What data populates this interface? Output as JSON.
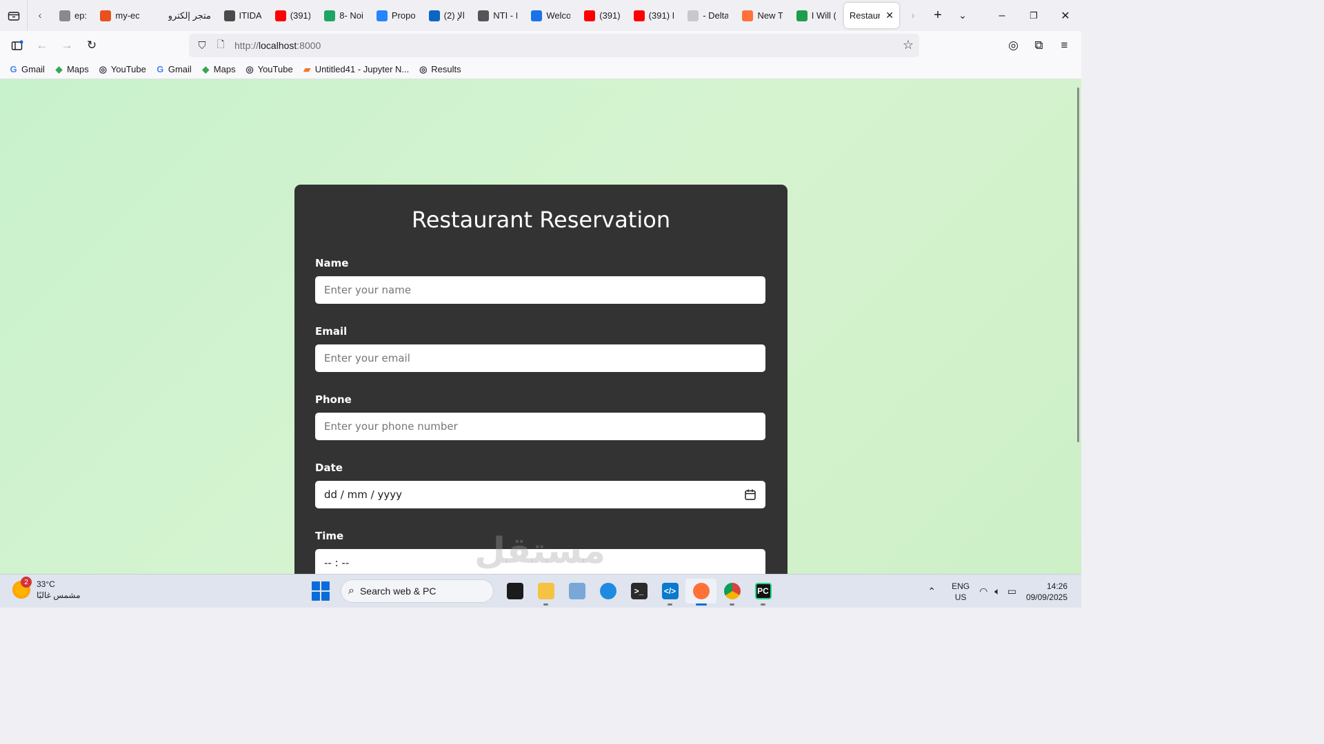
{
  "browser": {
    "tabs": [
      {
        "title": "ep:",
        "icon": "tab-icon",
        "color": "#8a8a8a"
      },
      {
        "title": "my-ec",
        "icon": "flame-icon",
        "color": "#e8501e"
      },
      {
        "title": "متجر إلكترو",
        "icon": "store-icon",
        "color": "#f0f0f4"
      },
      {
        "title": "ITIDA",
        "icon": "itida-icon",
        "color": "#4a4a4a"
      },
      {
        "title": "(391)",
        "icon": "youtube-icon",
        "color": "#ff0000"
      },
      {
        "title": "8- Noi",
        "icon": "drive-icon",
        "color": "#1fa463"
      },
      {
        "title": "Propo",
        "icon": "docs-icon",
        "color": "#2684fc"
      },
      {
        "title": "(2) الإ",
        "icon": "linkedin-icon",
        "color": "#0a66c2"
      },
      {
        "title": "NTI - I",
        "icon": "nti-icon",
        "color": "#555555"
      },
      {
        "title": "Welco",
        "icon": "c-icon",
        "color": "#1a73e8"
      },
      {
        "title": "(391)",
        "icon": "youtube-icon",
        "color": "#ff0000"
      },
      {
        "title": "(391) I",
        "icon": "youtube-icon",
        "color": "#ff0000"
      },
      {
        "title": "- Delta",
        "icon": "page-icon",
        "color": "#c7c7cc"
      },
      {
        "title": "New T",
        "icon": "firefox-icon",
        "color": "#ff7139"
      },
      {
        "title": "I Will (",
        "icon": "leaf-icon",
        "color": "#1e9e4a"
      },
      {
        "title": "Restaur",
        "icon": "",
        "color": "",
        "active": true
      }
    ],
    "url_prefix": "http://",
    "url_host": "localhost",
    "url_port": ":8000",
    "bookmarks": [
      {
        "label": "Gmail",
        "icon": "google-icon"
      },
      {
        "label": "Maps",
        "icon": "maps-icon"
      },
      {
        "label": "YouTube",
        "icon": "globe-icon"
      },
      {
        "label": "Gmail",
        "icon": "google-icon"
      },
      {
        "label": "Maps",
        "icon": "maps-icon"
      },
      {
        "label": "YouTube",
        "icon": "globe-icon"
      },
      {
        "label": "Untitled41 - Jupyter N...",
        "icon": "jupyter-icon"
      },
      {
        "label": "Results",
        "icon": "globe-icon"
      }
    ]
  },
  "page": {
    "title": "Restaurant Reservation",
    "form": {
      "name_label": "Name",
      "name_placeholder": "Enter your name",
      "email_label": "Email",
      "email_placeholder": "Enter your email",
      "phone_label": "Phone",
      "phone_placeholder": "Enter your phone number",
      "date_label": "Date",
      "date_value": "dd / mm / yyyy",
      "time_label": "Time",
      "time_value": "-- : --"
    },
    "watermark": "مستقل"
  },
  "taskbar": {
    "weather_temp": "33°C",
    "weather_desc": "مشمس غالبًا",
    "weather_badge": "2",
    "search_label": "Search web & PC",
    "lang_line1": "ENG",
    "lang_line2": "US",
    "time": "14:26",
    "date": "09/09/2025"
  },
  "colors": {
    "page_bg": "#c8f2cc",
    "card_bg": "#333333",
    "accent": "#0a6cdb"
  }
}
